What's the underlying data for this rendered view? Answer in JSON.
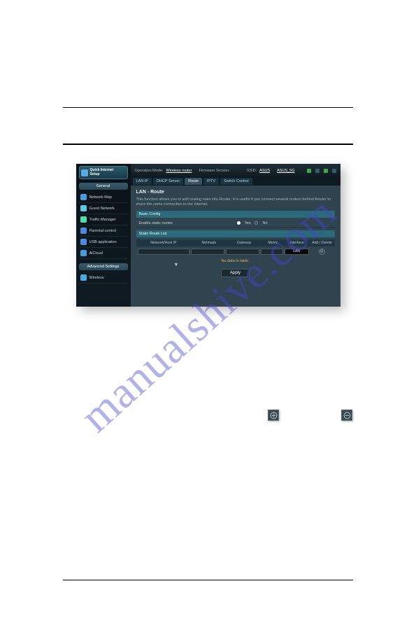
{
  "router": {
    "topbar": {
      "op_mode_label": "Operation Mode:",
      "op_mode_value": "Wireless router",
      "fw_label": "Firmware Version:",
      "ssid_label": "SSID:",
      "ssid1": "ASUS",
      "ssid2": "ASUS_5G"
    },
    "tabs": [
      "LAN IP",
      "DHCP Server",
      "Route",
      "IPTV",
      "Switch Control"
    ],
    "active_tab": 2,
    "page_title": "LAN - Route",
    "page_desc": "This function allows you to add routing rules into Router. It is useful if you connect several routers behind Router to share the same connection to the Internet.",
    "basic_cfg_title": "Basic Config",
    "enable_label": "Enable static routes",
    "radio_yes": "Yes",
    "radio_no": "No",
    "list_title": "Static Route List",
    "thead": {
      "c1": "Network/Host IP",
      "c2": "Netmask",
      "c3": "Gateway",
      "c4": "Metric",
      "c5": "Interface",
      "c6": "Add / Delete"
    },
    "interface_value": "LAN",
    "no_data": "No data in table.",
    "apply": "Apply",
    "sidebar": {
      "qis_line1": "Quick Internet",
      "qis_line2": "Setup",
      "general": "General",
      "items": [
        {
          "label": "Network Map",
          "cls": "i-blue"
        },
        {
          "label": "Guest Network",
          "cls": "i-grp"
        },
        {
          "label": "Traffic Manager",
          "cls": "i-trf"
        },
        {
          "label": "Parental control",
          "cls": "i-lock"
        },
        {
          "label": "USB application",
          "cls": "i-usb"
        },
        {
          "label": "AiCloud",
          "cls": "i-cld"
        }
      ],
      "advanced": "Advanced Settings",
      "adv_item": "Wireless"
    }
  },
  "watermark": "manualshive.com"
}
